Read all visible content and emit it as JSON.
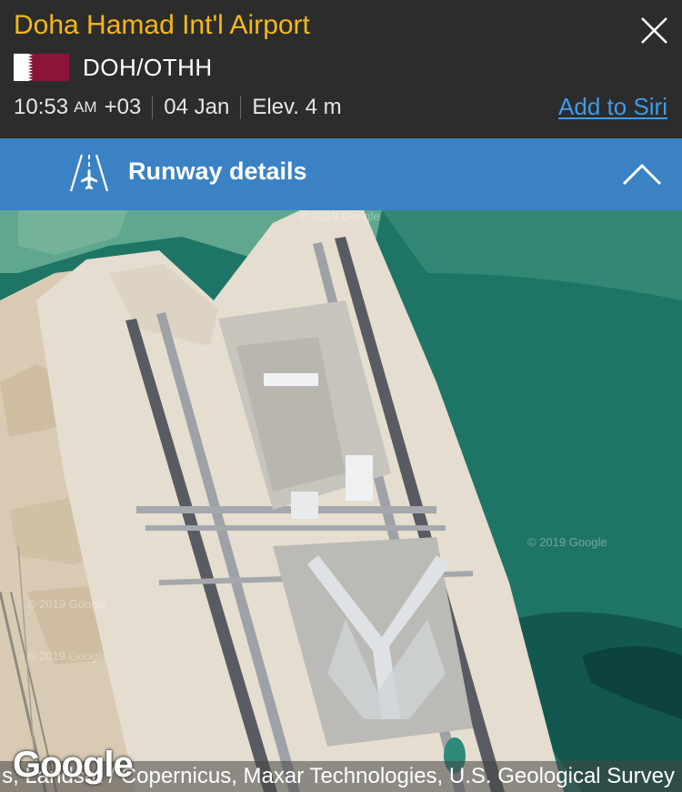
{
  "header": {
    "title": "Doha Hamad Int'l Airport",
    "codes": "DOH/OTHH",
    "time": "10:53",
    "ampm": "AM",
    "timezone": "+03",
    "date": "04 Jan",
    "elevation": "Elev. 4 m",
    "siri_link": "Add to Siri",
    "close_icon": "close-icon",
    "flag": "qatar-flag"
  },
  "runway_section": {
    "label": "Runway details",
    "icon": "runway-airplane-icon",
    "toggle_icon": "chevron-up-icon",
    "expanded": true
  },
  "map": {
    "type": "satellite",
    "logo": "Google",
    "attribution": "s, Landsat / Copernicus, Maxar Technologies, U.S. Geological Survey",
    "watermarks": [
      "2019 Google",
      "2019 Google",
      "2019 Google",
      "2019 Google"
    ]
  },
  "colors": {
    "header_bg": "#2c2c2c",
    "title": "#f5b818",
    "link": "#3f9be8",
    "section_bar": "#3a82c4",
    "sea": "#1e7566",
    "land": "#d9cbb3"
  }
}
